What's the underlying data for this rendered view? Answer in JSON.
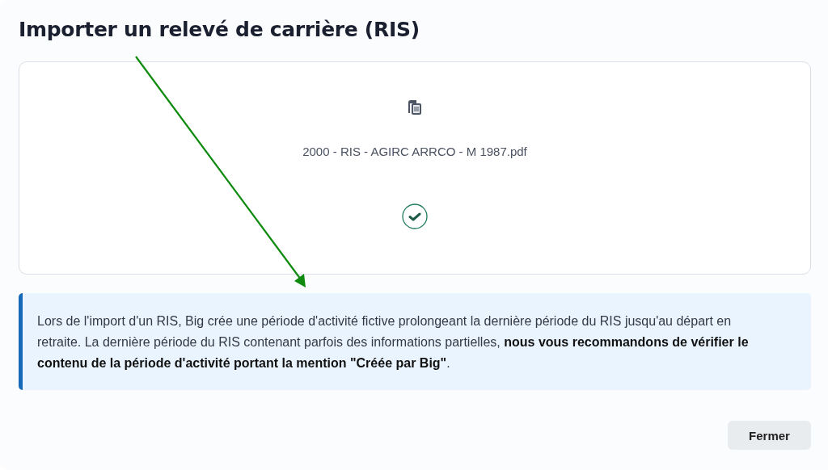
{
  "dialog": {
    "title": "Importer un relevé de carrière (RIS)"
  },
  "upload": {
    "file_name": "2000 - RIS - AGIRC ARRCO - M 1987.pdf",
    "done": true
  },
  "notice": {
    "text": "Lors de l'import d'un RIS, Big crée une période d'activité fictive prolongeant la dernière période du RIS jusqu'au départ en retraite. La dernière période du RIS contenant parfois des informations partielles, **nous vous recommandons de vérifier le contenu de la période d'activité portant la mention \"Créée par Big\"**."
  },
  "buttons": [
    {
      "label": "Fermer"
    }
  ]
}
